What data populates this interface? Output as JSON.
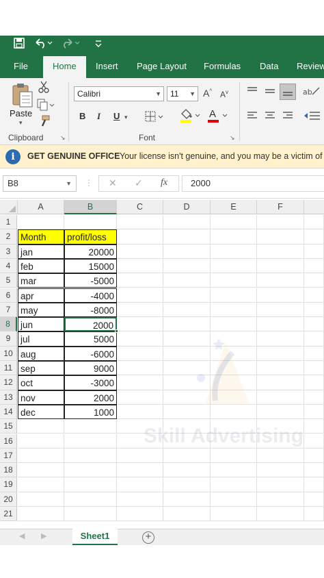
{
  "qat": {
    "save_icon": "save-icon",
    "undo_icon": "undo-icon",
    "redo_icon": "redo-icon",
    "customize_icon": "customize-icon"
  },
  "tabs": [
    "File",
    "Home",
    "Insert",
    "Page Layout",
    "Formulas",
    "Data",
    "Review"
  ],
  "ribbon": {
    "clipboard": {
      "paste_label": "Paste",
      "group_label": "Clipboard"
    },
    "font": {
      "font_name": "Calibri",
      "font_size": "11",
      "bold": "B",
      "italic": "I",
      "underline": "U",
      "increase": "A",
      "decrease": "A",
      "font_color_label": "A",
      "group_label": "Font"
    }
  },
  "banner": {
    "title": "GET GENUINE OFFICE",
    "message": "Your license isn't genuine, and you may be a victim of"
  },
  "formula_bar": {
    "name_box": "B8",
    "cancel_glyph": "✕",
    "enter_glyph": "✓",
    "fx_glyph": "fx",
    "formula": "2000"
  },
  "columns": [
    "A",
    "B",
    "C",
    "D",
    "E",
    "F"
  ],
  "rows": [
    "1",
    "2",
    "3",
    "4",
    "5",
    "6",
    "7",
    "8",
    "9",
    "10",
    "11",
    "12",
    "13",
    "14",
    "15",
    "16",
    "17",
    "18",
    "19",
    "20",
    "21"
  ],
  "header_row": {
    "month": "Month",
    "profit": "profit/loss"
  },
  "data_rows": [
    {
      "month": "jan",
      "value": "20000"
    },
    {
      "month": "feb",
      "value": "15000"
    },
    {
      "month": "mar",
      "value": "-5000"
    },
    {
      "month": "apr",
      "value": "-4000"
    },
    {
      "month": "may",
      "value": "-8000"
    },
    {
      "month": "jun",
      "value": "2000"
    },
    {
      "month": "jul",
      "value": "5000"
    },
    {
      "month": "aug",
      "value": "-6000"
    },
    {
      "month": "sep",
      "value": "9000"
    },
    {
      "month": "oct",
      "value": "-3000"
    },
    {
      "month": "nov",
      "value": "2000"
    },
    {
      "month": "dec",
      "value": "1000"
    }
  ],
  "watermark": "Skill Advertising",
  "sheet": {
    "tab_label": "Sheet1",
    "add_glyph": "+"
  },
  "colors": {
    "excel_green": "#217346",
    "banner_bg": "#fff2cc",
    "highlight": "#ffff00"
  }
}
